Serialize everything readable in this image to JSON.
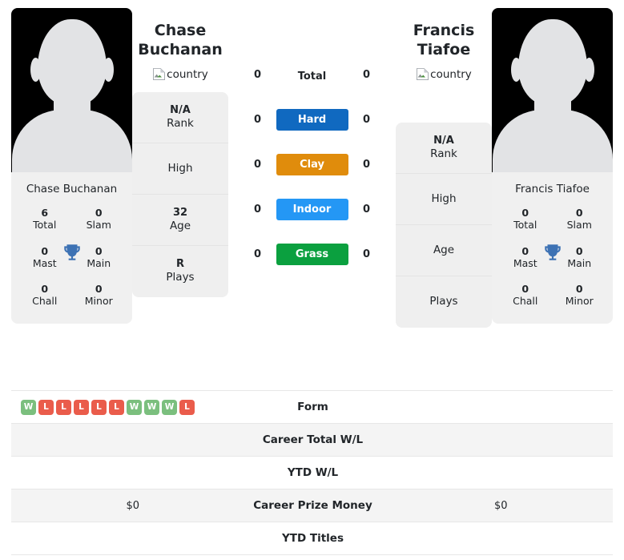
{
  "players": {
    "left": {
      "name": "Chase Buchanan",
      "name_line1": "Chase",
      "name_line2": "Buchanan",
      "photo_caption": "Chase Buchanan",
      "flag_alt": "country",
      "titles": {
        "total_value": "6",
        "total_label": "Total",
        "slam_value": "0",
        "slam_label": "Slam",
        "mast_value": "0",
        "mast_label": "Mast",
        "main_value": "0",
        "main_label": "Main",
        "chall_value": "0",
        "chall_label": "Chall",
        "minor_value": "0",
        "minor_label": "Minor"
      },
      "info": [
        {
          "value": "N/A",
          "label": "Rank"
        },
        {
          "value": "",
          "label": "High"
        },
        {
          "value": "32",
          "label": "Age"
        },
        {
          "value": "R",
          "label": "Plays"
        }
      ]
    },
    "right": {
      "name": "Francis Tiafoe",
      "name_line1": "Francis",
      "name_line2": "Tiafoe",
      "photo_caption": "Francis Tiafoe",
      "flag_alt": "country",
      "titles": {
        "total_value": "0",
        "total_label": "Total",
        "slam_value": "0",
        "slam_label": "Slam",
        "mast_value": "0",
        "mast_label": "Mast",
        "main_value": "0",
        "main_label": "Main",
        "chall_value": "0",
        "chall_label": "Chall",
        "minor_value": "0",
        "minor_label": "Minor"
      },
      "info": [
        {
          "value": "N/A",
          "label": "Rank"
        },
        {
          "value": "",
          "label": "High"
        },
        {
          "value": "",
          "label": "Age"
        },
        {
          "value": "",
          "label": "Plays"
        }
      ]
    }
  },
  "surfaces": [
    {
      "label": "Total",
      "left": "0",
      "right": "0",
      "badge": false,
      "color": ""
    },
    {
      "label": "Hard",
      "left": "0",
      "right": "0",
      "badge": true,
      "color": "#1069c0"
    },
    {
      "label": "Clay",
      "left": "0",
      "right": "0",
      "badge": true,
      "color": "#e08c0c"
    },
    {
      "label": "Indoor",
      "left": "0",
      "right": "0",
      "badge": true,
      "color": "#2497f5"
    },
    {
      "label": "Grass",
      "left": "0",
      "right": "0",
      "badge": true,
      "color": "#0ba03f"
    }
  ],
  "form": {
    "label": "Form",
    "left_results": [
      "W",
      "L",
      "L",
      "L",
      "L",
      "L",
      "W",
      "W",
      "W",
      "L"
    ],
    "right_results": []
  },
  "stats_rows": [
    {
      "label": "Career Total W/L",
      "left": "",
      "right": ""
    },
    {
      "label": "YTD W/L",
      "left": "",
      "right": ""
    },
    {
      "label": "Career Prize Money",
      "left": "$0",
      "right": "$0"
    },
    {
      "label": "YTD Titles",
      "left": "",
      "right": ""
    }
  ],
  "colors": {
    "win_badge": "#7bbf7e",
    "loss_badge": "#ea5c4b",
    "trophy": "#3d72b4",
    "card_bg": "#efefef",
    "row_shade": "#f4f4f4"
  }
}
